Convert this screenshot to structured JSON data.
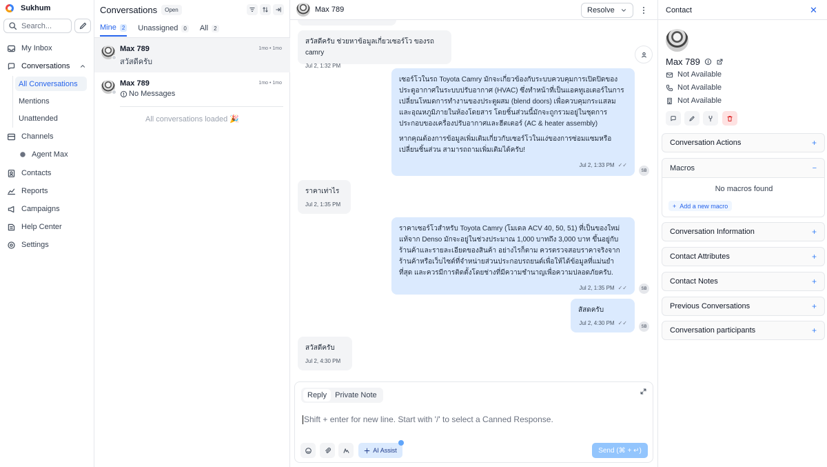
{
  "sidebar": {
    "account_name": "Sukhum",
    "search_placeholder": "Search...",
    "items": {
      "inbox": "My Inbox",
      "conversations": "Conversations",
      "all_conversations": "All Conversations",
      "mentions": "Mentions",
      "unattended": "Unattended",
      "channels": "Channels",
      "agent": "Agent Max",
      "contacts": "Contacts",
      "reports": "Reports",
      "campaigns": "Campaigns",
      "help_center": "Help Center",
      "settings": "Settings"
    }
  },
  "list": {
    "title": "Conversations",
    "status_badge": "Open",
    "tabs": [
      {
        "label": "Mine",
        "count": "2"
      },
      {
        "label": "Unassigned",
        "count": "0"
      },
      {
        "label": "All",
        "count": "2"
      }
    ],
    "conversations": [
      {
        "name": "Max 789",
        "preview": "สวัสดีครับ",
        "time": "1mo • 1mo"
      },
      {
        "name": "Max 789",
        "preview": "No Messages",
        "time": "1mo • 1mo"
      }
    ],
    "footer": "All conversations loaded 🎉"
  },
  "chat": {
    "contact_name": "Max 789",
    "resolve_label": "Resolve",
    "messages": [
      {
        "text": "สวัสดีครับ ช่วยหาข้อมูลเกี่ยวเซอร์โว ของรถ camry",
        "time": "Jul 2, 1:32 PM"
      },
      {
        "p1": "เซอร์โวในรถ Toyota Camry มักจะเกี่ยวข้องกับระบบควบคุมการเปิดปิดของประตูอากาศในระบบปรับอากาศ (HVAC) ซึ่งทำหน้าที่เป็นแอคทูเอเตอร์ในการเปลี่ยนโหมดการทำงานของประตูผสม (blend doors) เพื่อควบคุมกระแสลมและอุณหภูมิภายในห้องโดยสาร โดยชิ้นส่วนนี้มักจะถูกรวมอยู่ในชุดการประกอบของเครื่องปรับอากาศและฮีตเตอร์ (AC & heater assembly)",
        "p2": "หากคุณต้องการข้อมูลเพิ่มเติมเกี่ยวกับเซอร์โวในแง่ของการซ่อมแซมหรือเปลี่ยนชิ้นส่วน สามารถถามเพิ่มเติมได้ครับ!",
        "time": "Jul 2, 1:33 PM",
        "avatar": "SB"
      },
      {
        "text": "ราคาเท่าไร",
        "time": "Jul 2, 1:35 PM"
      },
      {
        "text": "ราคาเซอร์โวสำหรับ Toyota Camry (โมเดล ACV 40, 50, 51) ที่เป็นของใหม่แท้จาก Denso มักจะอยู่ในช่วงประมาณ 1,000 บาทถึง 3,000 บาท ขึ้นอยู่กับร้านค้าและรายละเอียดของสินค้า อย่างไรก็ตาม ควรตรวจสอบราคาจริงจากร้านค้าหรือเว็บไซต์ที่จำหน่ายส่วนประกอบรถยนต์เพื่อให้ได้ข้อมูลที่แม่นยำที่สุด และควรมีการติดตั้งโดยช่างที่มีความชำนาญเพื่อความปลอดภัยครับ.",
        "time": "Jul 2, 1:35 PM",
        "avatar": "SB"
      },
      {
        "text": "สัสดครับ",
        "time": "Jul 2, 4:30 PM",
        "avatar": "SB"
      },
      {
        "text": "สวัสดีครับ",
        "time": "Jul 2, 4:30 PM"
      }
    ],
    "composer": {
      "reply_tab": "Reply",
      "note_tab": "Private Note",
      "placeholder": "Shift + enter for new line. Start with '/' to select a Canned Response.",
      "ai_label": "AI Assist",
      "send_label": "Send (⌘ + ↵)"
    }
  },
  "contact": {
    "title": "Contact",
    "name": "Max 789",
    "email": "Not Available",
    "phone": "Not Available",
    "company": "Not Available",
    "sections": {
      "actions": "Conversation Actions",
      "macros": "Macros",
      "no_macros": "No macros found",
      "add_macro": "Add a new macro",
      "information": "Conversation Information",
      "attributes": "Contact Attributes",
      "notes": "Contact Notes",
      "previous": "Previous Conversations",
      "participants": "Conversation participants"
    }
  }
}
